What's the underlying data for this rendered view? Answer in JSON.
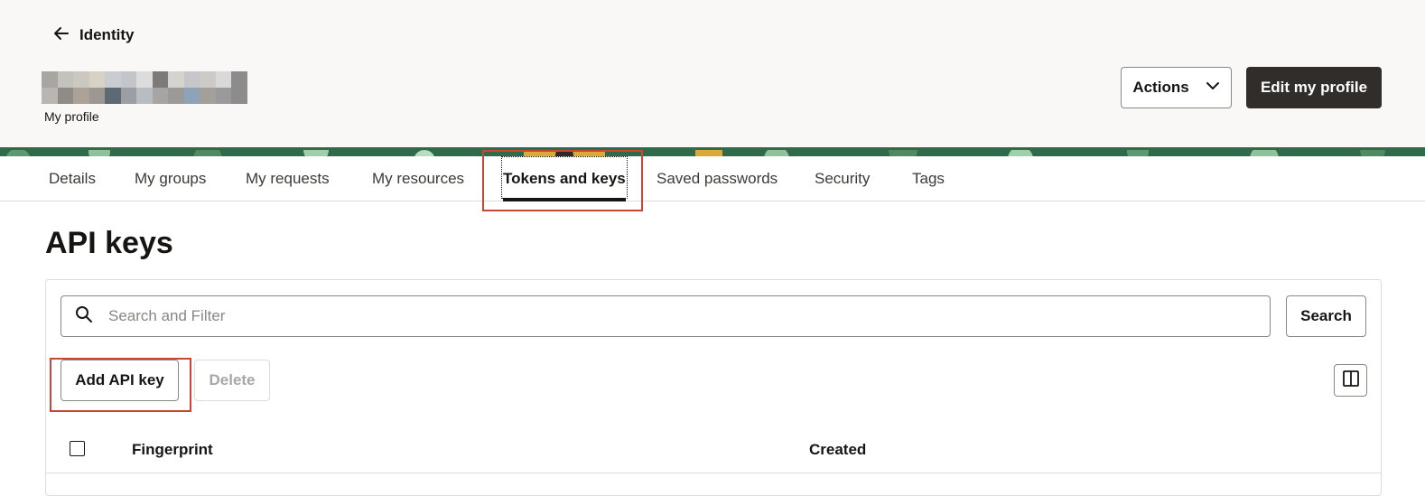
{
  "header": {
    "back_label": "Identity",
    "profile_caption": "My profile",
    "actions_label": "Actions",
    "edit_label": "Edit my profile"
  },
  "tabs": [
    {
      "label": "Details"
    },
    {
      "label": "My groups"
    },
    {
      "label": "My requests"
    },
    {
      "label": "My resources"
    },
    {
      "label": "Tokens and keys",
      "active": true
    },
    {
      "label": "Saved passwords"
    },
    {
      "label": "Security"
    },
    {
      "label": "Tags"
    }
  ],
  "main": {
    "title": "API keys",
    "search": {
      "placeholder": "Search and Filter",
      "value": "",
      "button_label": "Search"
    },
    "toolbar": {
      "add_label": "Add API key",
      "delete_label": "Delete"
    },
    "table": {
      "columns": [
        "Fingerprint",
        "Created"
      ]
    }
  },
  "colors": {
    "header_bg": "#f9f8f6",
    "primary_button": "#312d2a",
    "highlight": "#c74634",
    "banner": "#2f6b4a"
  },
  "icons": {
    "back": "arrow-left-icon",
    "actions": "chevron-down-icon",
    "search": "search-icon",
    "columns": "column-layout-icon"
  }
}
